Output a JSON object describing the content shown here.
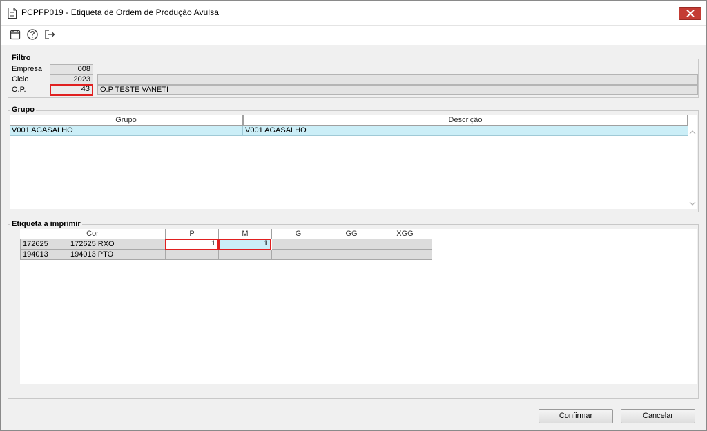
{
  "window": {
    "title": "PCPFP019 - Etiqueta de Ordem de Produção Avulsa"
  },
  "toolbar": {
    "icons": [
      "calendar-icon",
      "help-icon",
      "exit-icon"
    ]
  },
  "filtro": {
    "legend": "Filtro",
    "empresa_label": "Empresa",
    "empresa_value": "008",
    "ciclo_label": "Ciclo",
    "ciclo_value": "2023",
    "op_label": "O.P.",
    "op_value": "43",
    "ciclo_desc": "",
    "op_desc": "O.P TESTE VANETI"
  },
  "grupo": {
    "legend": "Grupo",
    "columns": [
      "Grupo",
      "Descrição"
    ],
    "rows": [
      [
        "V001 AGASALHO",
        "V001 AGASALHO"
      ]
    ]
  },
  "etiqueta": {
    "legend": "Etiqueta a imprimir",
    "cor_header": "Cor",
    "size_headers": [
      "P",
      "M",
      "G",
      "GG",
      "XGG"
    ],
    "rows": [
      {
        "code": "172625",
        "cor": "172625 RXO",
        "sizes": [
          "1",
          "1",
          "",
          "",
          ""
        ]
      },
      {
        "code": "194013",
        "cor": "194013 PTO",
        "sizes": [
          "",
          "",
          "",
          "",
          ""
        ]
      }
    ]
  },
  "buttons": {
    "confirmar_pre": "C",
    "confirmar_u": "o",
    "confirmar_post": "nfirmar",
    "cancelar_u": "C",
    "cancelar_post": "ancelar"
  },
  "colors": {
    "selection": "#cbeef7",
    "error_outline": "#e02020",
    "close_button": "#c43c34"
  }
}
